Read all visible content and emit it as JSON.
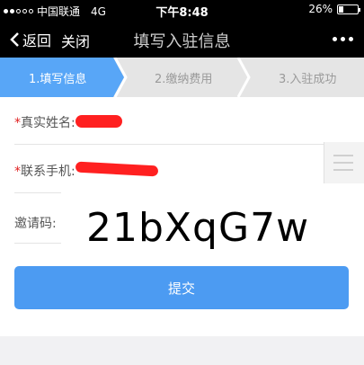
{
  "status_bar": {
    "carrier": "中国联通",
    "network": "4G",
    "time": "下午8:48",
    "battery": "26%",
    "battery_level": 0.26
  },
  "nav": {
    "back_label": "返回",
    "close_label": "关闭",
    "title": "填写入驻信息",
    "more_icon": "more-dots-icon"
  },
  "steps": [
    {
      "label": "1.填写信息",
      "active": true
    },
    {
      "label": "2.缴纳费用",
      "active": false
    },
    {
      "label": "3.入驻成功",
      "active": false
    }
  ],
  "form": {
    "required_mark": "*",
    "name_label": "真实姓名:",
    "phone_label": "联系手机:",
    "invite_label": "邀请码:",
    "invite_value": "21bXqG7w"
  },
  "submit_label": "提交",
  "colors": {
    "accent": "#4c9bf2",
    "active_step": "#58a6f7",
    "required": "#e02020",
    "redaction": "#ff2020"
  }
}
